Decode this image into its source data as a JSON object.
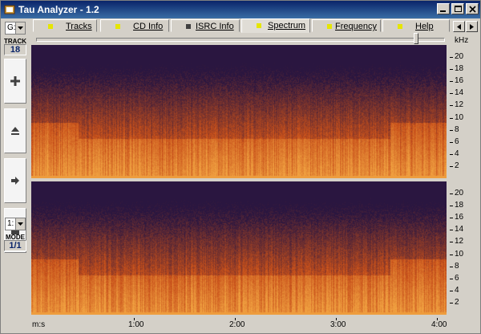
{
  "window": {
    "title": "Tau Analyzer - 1.2",
    "controls": [
      "minimize",
      "maximize",
      "close"
    ]
  },
  "left_panel": {
    "drive": {
      "value": "G:"
    },
    "track": {
      "label": "TRACK",
      "value": "18"
    },
    "buttons": [
      {
        "name": "play-button",
        "icon": "play-icon"
      },
      {
        "name": "eject-button",
        "icon": "eject-icon"
      },
      {
        "name": "next-button",
        "icon": "arrow-right-icon"
      },
      {
        "name": "stop-button",
        "icon": "stop-icon"
      }
    ],
    "channel_select": {
      "value": "1:"
    },
    "mode": {
      "label": "MODE",
      "value": "1/1"
    }
  },
  "tabs": [
    {
      "label": "Tracks",
      "dot_color": "#e6e600"
    },
    {
      "label": "CD Info",
      "dot_color": "#e6e600"
    },
    {
      "label": "ISRC Info",
      "dot_color": "#404040"
    },
    {
      "label": "Spectrum",
      "dot_color": "#e6e600",
      "active": true
    },
    {
      "label": "Frequency",
      "dot_color": "#e6e600"
    },
    {
      "label": "Help",
      "dot_color": "#e6e600"
    }
  ],
  "slider": {
    "value_fraction": 0.94
  },
  "spectrum": {
    "unit_label": "kHz",
    "y_ticks": [
      "20",
      "18",
      "16",
      "14",
      "12",
      "10",
      "8",
      "6",
      "4",
      "2"
    ],
    "x_axis_label": "m:s",
    "x_ticks": [
      "1:00",
      "2:00",
      "3:00",
      "4:00"
    ],
    "colors": {
      "low": "#2a1640",
      "mid": "#c8501a",
      "high": "#f0a040"
    }
  }
}
